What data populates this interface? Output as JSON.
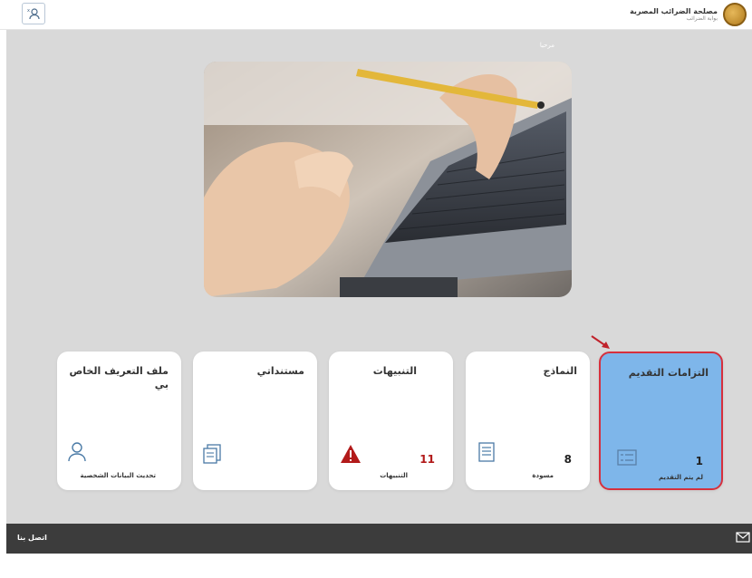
{
  "header": {
    "brand_title": "مصلحة الضرائب المصرية",
    "brand_subtitle": "بوابة الضرائب",
    "user_button_icon": "user-switch-icon"
  },
  "main": {
    "welcome_text": "مرحبا",
    "hero_image_alt": "hands-on-laptop-keyboard"
  },
  "cards": [
    {
      "id": "filing-obligations",
      "title": "التزامات التقديم",
      "count": "1",
      "label": "لم يتم التقديم",
      "icon": "form-list-icon",
      "active": true
    },
    {
      "id": "forms",
      "title": "النماذج",
      "count": "8",
      "label": "مسودة",
      "icon": "document-icon",
      "active": false
    },
    {
      "id": "alerts",
      "title": "التنبيهات",
      "count": "11",
      "label": "التنبيهات",
      "icon": "warning-icon",
      "active": false
    },
    {
      "id": "my-documents",
      "title": "مستنداتي",
      "count": "",
      "label": "",
      "icon": "documents-icon",
      "active": false
    },
    {
      "id": "profile",
      "title": "ملف التعريف الخاص بي",
      "count": "",
      "label": "تحديث البيانات الشخصية",
      "icon": "person-icon",
      "active": false
    }
  ],
  "footer": {
    "contact_label": "اتصل بنا",
    "mail_icon": "mail-icon"
  },
  "colors": {
    "active_card_bg": "#7eb6ea",
    "active_card_border": "#d6303d",
    "warning_red": "#b21a1a",
    "page_bg": "#d9d9d9",
    "footer_bg": "#3c3c3c"
  }
}
